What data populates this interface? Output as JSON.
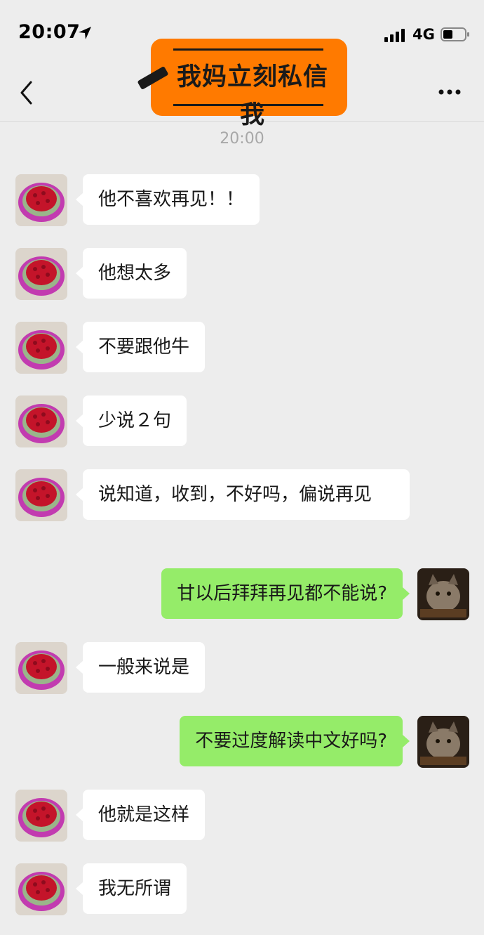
{
  "status_bar": {
    "time": "20:07",
    "network": "4G"
  },
  "header": {
    "banner_text": "我妈立刻私信我"
  },
  "chat": {
    "timestamp": "20:00",
    "messages": [
      {
        "side": "in",
        "text": "他不喜欢再见！！"
      },
      {
        "side": "in",
        "text": "他想太多"
      },
      {
        "side": "in",
        "text": "不要跟他牛"
      },
      {
        "side": "in",
        "text": "少说２句"
      },
      {
        "side": "in",
        "text": "说知道，收到，不好吗，偏说再见"
      },
      {
        "side": "out",
        "text": "甘以后拜拜再见都不能说?"
      },
      {
        "side": "in",
        "text": "一般来说是"
      },
      {
        "side": "out",
        "text": "不要过度解读中文好吗?"
      },
      {
        "side": "in",
        "text": "他就是这样"
      },
      {
        "side": "in",
        "text": "我无所谓"
      }
    ]
  },
  "icons": {
    "back": "back-chevron-icon",
    "more": "more-dots-icon",
    "location": "location-arrow-icon",
    "signal": "signal-bars-icon",
    "battery": "battery-icon"
  },
  "colors": {
    "background": "#ededed",
    "incoming_bubble": "#ffffff",
    "outgoing_bubble": "#95ec69",
    "banner": "#ff7a00",
    "timestamp": "#a8a8a8"
  }
}
